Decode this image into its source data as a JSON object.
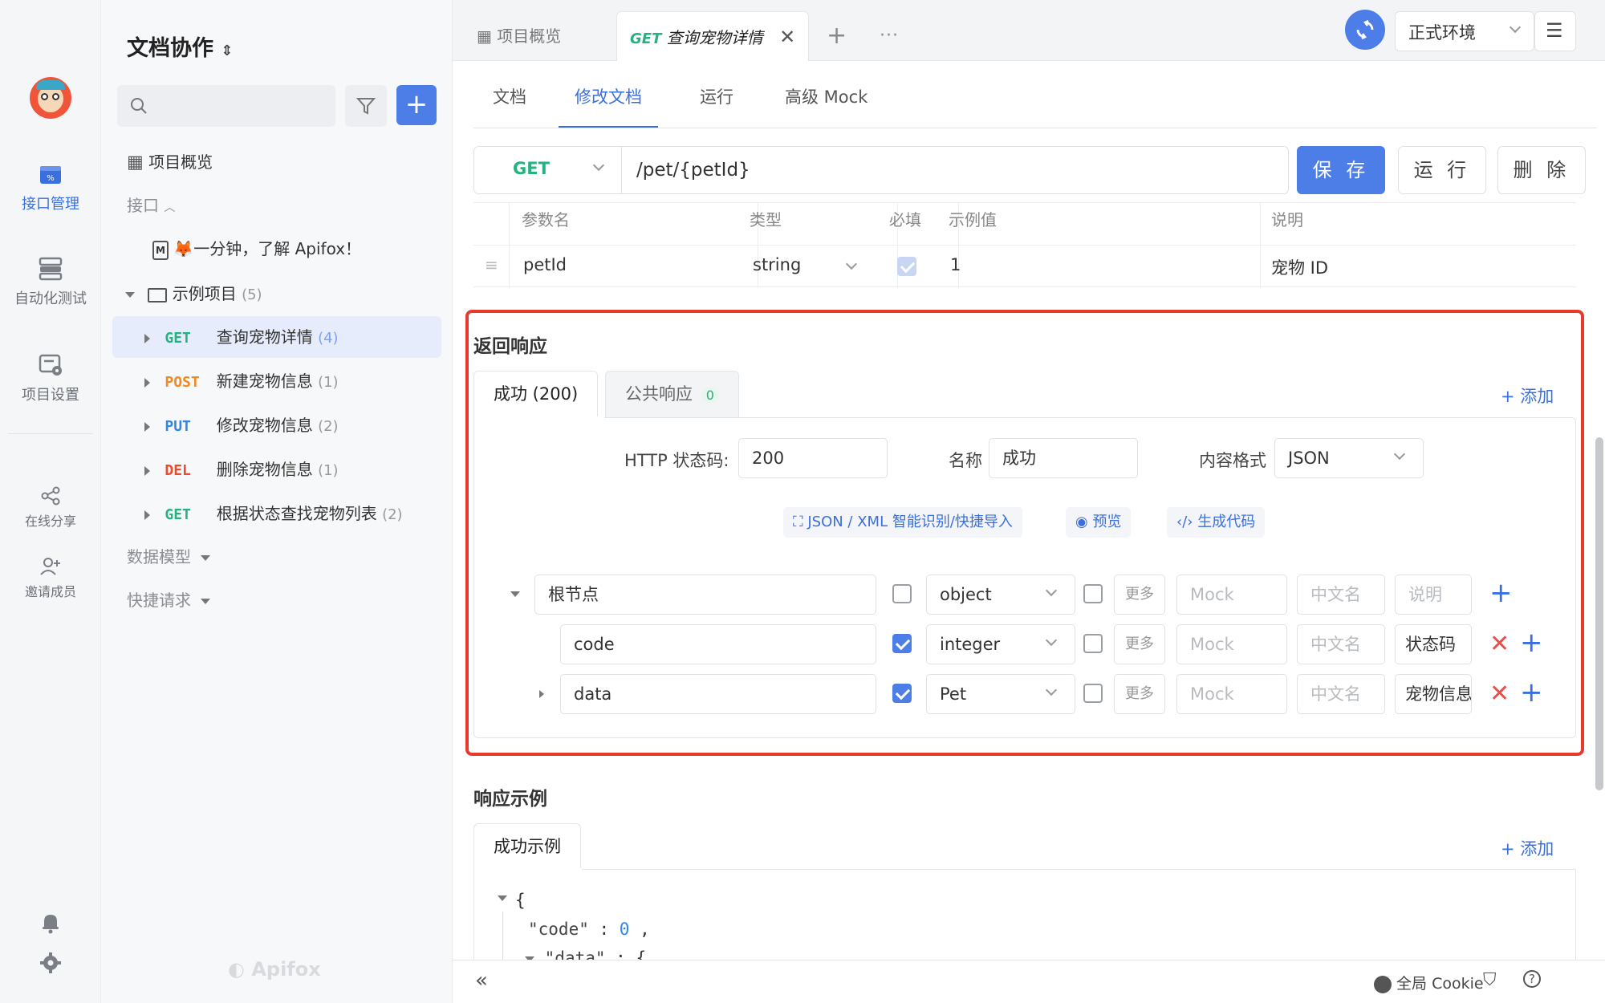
{
  "app": {
    "project_name": "文档协作",
    "brand": "Apifox"
  },
  "rail": {
    "items": [
      {
        "label": "接口管理"
      },
      {
        "label": "自动化测试"
      },
      {
        "label": "项目设置"
      },
      {
        "label": "在线分享"
      },
      {
        "label": "邀请成员"
      }
    ]
  },
  "sidebar": {
    "overview": "项目概览",
    "section_interfaces": "接口",
    "intro_doc": "🦊一分钟，了解 Apifox！",
    "folder": {
      "name": "示例项目",
      "count": "(5)"
    },
    "endpoints": [
      {
        "method": "GET",
        "name": "查询宠物详情",
        "count": "(4)"
      },
      {
        "method": "POST",
        "name": "新建宠物信息",
        "count": "(1)"
      },
      {
        "method": "PUT",
        "name": "修改宠物信息",
        "count": "(2)"
      },
      {
        "method": "DEL",
        "name": "删除宠物信息",
        "count": "(1)"
      },
      {
        "method": "GET",
        "name": "根据状态查找宠物列表",
        "count": "(2)"
      }
    ],
    "section_models": "数据模型",
    "section_quick": "快捷请求"
  },
  "tabs": {
    "overview": "项目概览",
    "active_method": "GET",
    "active_name": "查询宠物详情",
    "env": "正式环境"
  },
  "subtabs": [
    "文档",
    "修改文档",
    "运行",
    "高级 Mock"
  ],
  "request": {
    "method": "GET",
    "path": "/pet/{petId}",
    "save": "保 存",
    "run": "运 行",
    "delete": "删 除"
  },
  "params": {
    "headers": [
      "参数名",
      "类型",
      "必填",
      "示例值",
      "说明"
    ],
    "row": {
      "name": "petId",
      "type": "string",
      "example": "1",
      "desc": "宠物 ID"
    }
  },
  "response": {
    "title": "返回响应",
    "tab_success": "成功 (200)",
    "tab_common": "公共响应",
    "tab_common_count": "0",
    "add": "+ 添加",
    "status_label": "HTTP 状态码:",
    "status_value": "200",
    "name_label": "名称",
    "name_value": "成功",
    "format_label": "内容格式",
    "format_value": "JSON",
    "tools": [
      "JSON / XML 智能识别/快捷导入",
      "预览",
      "生成代码"
    ],
    "more": "更多",
    "ph_mock": "Mock",
    "ph_cn": "中文名",
    "ph_desc": "说明",
    "fields": [
      {
        "name": "根节点",
        "type": "object",
        "desc": ""
      },
      {
        "name": "code",
        "type": "integer",
        "desc": "状态码"
      },
      {
        "name": "data",
        "type": "Pet",
        "desc": "宠物信息"
      }
    ]
  },
  "example": {
    "title": "响应示例",
    "tab": "成功示例",
    "add": "+ 添加",
    "code_open": "{",
    "line_code_key": "\"code\"",
    "line_code_val": "0",
    "line_data_key": "\"data\"",
    "line_data_open": "{"
  },
  "footer": {
    "cookie": "全局 Cookie"
  },
  "colors": {
    "accent": "#4d7ee8",
    "get": "#26b27e",
    "post": "#f28a20",
    "put": "#2f88ea",
    "del": "#ec4b2f",
    "highlight_frame": "#e63a2e"
  }
}
